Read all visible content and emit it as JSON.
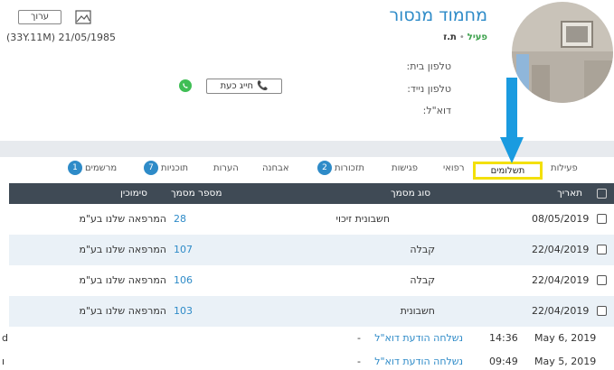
{
  "patient": {
    "name": "מחמוד מנסור",
    "status": "פעיל",
    "id_label": "ת.ז",
    "dob_text": "(33Y.11M) 21/05/1985",
    "edit_label": "ערוך"
  },
  "contact": {
    "home_phone_label": "טלפון בית:",
    "mobile_phone_label": "טלפון נייד:",
    "email_label": "דוא\"ל:",
    "call_now_label": "חייג כעת"
  },
  "tabs": [
    {
      "label": "פעילות"
    },
    {
      "label": "תשלומים",
      "active": true
    },
    {
      "label": "רפואי"
    },
    {
      "label": "פגישות"
    },
    {
      "label": "תזכורות",
      "badge": "2"
    },
    {
      "label": "אבחנה"
    },
    {
      "label": "הערות"
    },
    {
      "label": "תוכניות",
      "badge": "7"
    },
    {
      "label": "מרשמים",
      "badge": "1"
    }
  ],
  "table": {
    "headers": {
      "date": "תאריך",
      "doc_type": "סוג מסמך",
      "doc_number": "מספר מסמך",
      "signer": "סימוכין"
    },
    "rows": [
      {
        "date": "08/05/2019",
        "doc_type": "חשבונית זיכוי",
        "doc_number": "28",
        "signer": "המרפאה שלנו בע\"מ"
      },
      {
        "date": "22/04/2019",
        "doc_type": "קבלה",
        "doc_number": "107",
        "signer": "המרפאה שלנו בע\"מ"
      },
      {
        "date": "22/04/2019",
        "doc_type": "קבלה",
        "doc_number": "106",
        "signer": "המרפאה שלנו בע\"מ"
      },
      {
        "date": "22/04/2019",
        "doc_type": "חשבונית",
        "doc_number": "103",
        "signer": "המרפאה שלנו בע\"מ"
      }
    ]
  },
  "activity": [
    {
      "date": "May 6, 2019",
      "time": "14:36",
      "event": "נשלחה הודעת דוא\"ל",
      "dash": "-",
      "edge": "d"
    },
    {
      "date": "May 5, 2019",
      "time": "09:49",
      "event": "נשלחה הודעת דוא\"ל",
      "dash": "-",
      "edge": "ו"
    }
  ],
  "colors": {
    "accent": "#2e8bc8",
    "active": "#3aa04a",
    "header_bg": "#3f4a55",
    "highlight": "#f3e00a",
    "arrow": "#1a9be0"
  }
}
